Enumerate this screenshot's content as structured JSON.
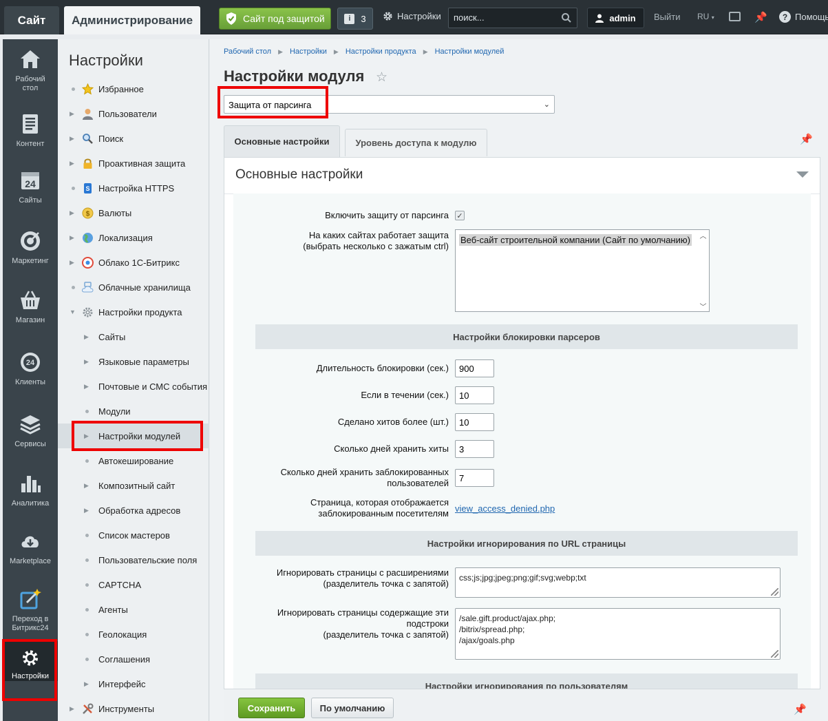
{
  "topbar": {
    "site_tab": "Сайт",
    "admin_tab": "Администрирование",
    "protect_label": "Сайт под защитой",
    "notif_count": "3",
    "settings_label": "Настройки",
    "search_placeholder": "поиск...",
    "user": "admin",
    "logout": "Выйти",
    "lang": "RU",
    "help": "Помощь"
  },
  "rail": {
    "items": [
      {
        "label": "Рабочий стол",
        "icon": "home-icon"
      },
      {
        "label": "Контент",
        "icon": "document-icon"
      },
      {
        "label": "Сайты",
        "icon": "calendar-24-icon"
      },
      {
        "label": "Маркетинг",
        "icon": "target-icon"
      },
      {
        "label": "Магазин",
        "icon": "basket-icon"
      },
      {
        "label": "Клиенты",
        "icon": "clients-24-icon"
      },
      {
        "label": "Сервисы",
        "icon": "layers-icon"
      },
      {
        "label": "Аналитика",
        "icon": "bar-chart-icon"
      },
      {
        "label": "Marketplace",
        "icon": "cloud-download-icon"
      },
      {
        "label": "Переход в Битрикс24",
        "icon": "external-link-icon"
      },
      {
        "label": "Настройки",
        "icon": "gear-icon"
      }
    ]
  },
  "menu": {
    "title": "Настройки",
    "items": [
      {
        "label": "Избранное"
      },
      {
        "label": "Пользователи"
      },
      {
        "label": "Поиск"
      },
      {
        "label": "Проактивная защита"
      },
      {
        "label": "Настройка HTTPS"
      },
      {
        "label": "Валюты"
      },
      {
        "label": "Локализация"
      },
      {
        "label": "Облако 1С-Битрикс"
      },
      {
        "label": "Облачные хранилища"
      },
      {
        "label": "Настройки продукта"
      },
      {
        "label": "Сайты"
      },
      {
        "label": "Языковые параметры"
      },
      {
        "label": "Почтовые и СМС события"
      },
      {
        "label": "Модули"
      },
      {
        "label": "Настройки модулей"
      },
      {
        "label": "Автокеширование"
      },
      {
        "label": "Композитный сайт"
      },
      {
        "label": "Обработка адресов"
      },
      {
        "label": "Список мастеров"
      },
      {
        "label": "Пользовательские поля"
      },
      {
        "label": "CAPTCHA"
      },
      {
        "label": "Агенты"
      },
      {
        "label": "Геолокация"
      },
      {
        "label": "Соглашения"
      },
      {
        "label": "Интерфейс"
      },
      {
        "label": "Инструменты"
      }
    ]
  },
  "breadcrumbs": [
    "Рабочий стол",
    "Настройки",
    "Настройки продукта",
    "Настройки модулей"
  ],
  "page_title": "Настройки модуля",
  "module_select": "Защита от парсинга",
  "tabs": [
    "Основные настройки",
    "Уровень доступа к модулю"
  ],
  "panel_title": "Основные настройки",
  "form": {
    "enable_label": "Включить защиту от парсинга",
    "enable_checked": true,
    "sites_label_1": "На каких сайтах работает защита",
    "sites_label_2": "(выбрать несколько с зажатым ctrl)",
    "sites_option": "Веб-сайт строительной компании (Сайт по умолчанию)",
    "section_block": "Настройки блокировки парсеров",
    "block_duration_label": "Длительность блокировки (сек.)",
    "block_duration": "900",
    "within_label": "Если в течении (сек.)",
    "within": "10",
    "hits_label": "Сделано хитов более (шт.)",
    "hits": "10",
    "keep_hits_label": "Сколько дней хранить хиты",
    "keep_hits": "3",
    "keep_blocked_label_1": "Сколько дней хранить заблокированных",
    "keep_blocked_label_2": "пользователей",
    "keep_blocked": "7",
    "page_label_1": "Страница, которая отображается",
    "page_label_2": "заблокированным посетителям",
    "page_link": "view_access_denied.php",
    "section_url": "Настройки игнорирования по URL страницы",
    "ext_label_1": "Игнорировать страницы с расширениями",
    "ext_label_2": "(разделитель точка с запятой)",
    "ext_value": "css;js;jpg;jpeg;png;gif;svg;webp;txt",
    "substr_label_1": "Игнорировать страницы содержащие эти",
    "substr_label_2": "подстроки",
    "substr_label_3": "(разделитель точка с запятой)",
    "substr_value": "/sale.gift.product/ajax.php;\n/bitrix/spread.php;\n/ajax/goals.php",
    "section_users": "Настройки игнорирования по пользователям"
  },
  "footer": {
    "save": "Сохранить",
    "default": "По умолчанию"
  }
}
